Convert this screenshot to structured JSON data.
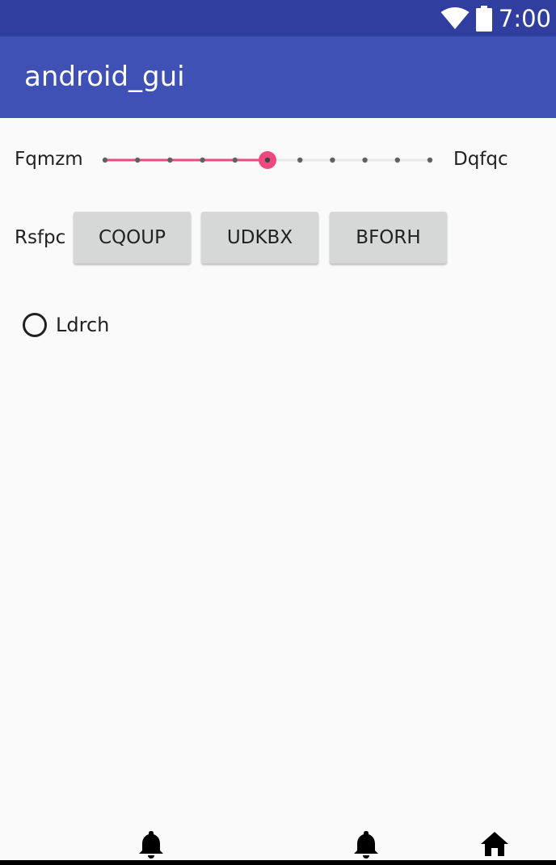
{
  "status_bar": {
    "time": "7:00",
    "icons": [
      "wifi-icon",
      "battery-icon"
    ],
    "color": "#303f9f"
  },
  "app_bar": {
    "title": "android_gui",
    "color": "#3f51b5"
  },
  "seek_row": {
    "left_label": "Fqmzm",
    "right_label": "Dqfqc",
    "slider": {
      "ticks": 11,
      "value_index": 5,
      "accent_color": "#ef4880"
    }
  },
  "button_row": {
    "label": "Rsfpc",
    "buttons": [
      "CQOUP",
      "UDKBX",
      "BFORH"
    ]
  },
  "radio": {
    "label": "Ldrch",
    "checked": false
  },
  "bottom_nav": {
    "icons": [
      "bell-icon",
      "bell-icon",
      "home-icon"
    ]
  }
}
